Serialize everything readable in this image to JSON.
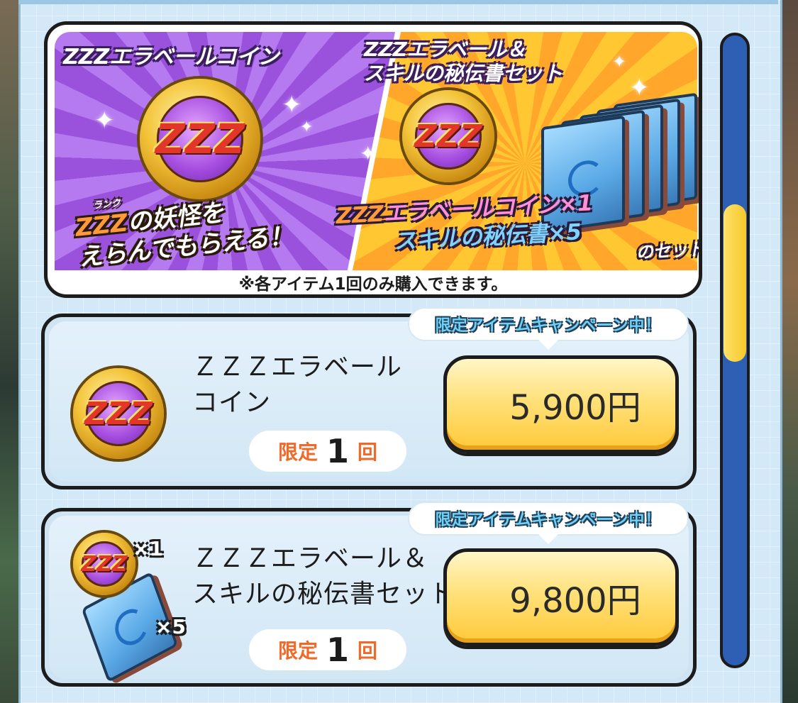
{
  "banner": {
    "left_title": "ZZZエラベールコイン",
    "right_title_line1": "ZZZエラベール＆",
    "right_title_line2": "スキルの秘伝書セット",
    "left_ruby": "ランク",
    "left_sub_zzz": "ZZZ",
    "left_sub_line1": "の妖怪を",
    "left_sub_line2": "えらんでもらえる！",
    "right_sub_zzz": "ZZZ",
    "right_sub_coin": "エラベールコイン×1",
    "right_sub_book": "スキルの秘伝書×5",
    "right_sub_end": "のセット！",
    "note": "※各アイテム1回のみ購入できます。"
  },
  "items": [
    {
      "title": "ＺＺＺエラベール\nコイン",
      "campaign": "限定アイテムキャンペーン中！",
      "price": "5,900円",
      "limit_label": "限定",
      "limit_num": "1",
      "limit_unit": "回"
    },
    {
      "title": "ＺＺＺエラベール＆\nスキルの秘伝書セット",
      "campaign": "限定アイテムキャンペーン中！",
      "price": "9,800円",
      "limit_label": "限定",
      "limit_num": "1",
      "limit_unit": "回",
      "qty_coin": "×1",
      "qty_book": "×5"
    }
  ],
  "coin_glyph": "ZZZ",
  "icons": [
    "zzz-coin-icon",
    "skill-book-icon",
    "sparkle-icon"
  ],
  "colors": {
    "panel_bg": "#d3e9f7",
    "price_button": "#ffd54a",
    "limit_label": "#ee6a2a",
    "campaign_text": "#6fd1f5",
    "scroll_track": "#2d5fb4",
    "scroll_thumb": "#f6c82a"
  }
}
